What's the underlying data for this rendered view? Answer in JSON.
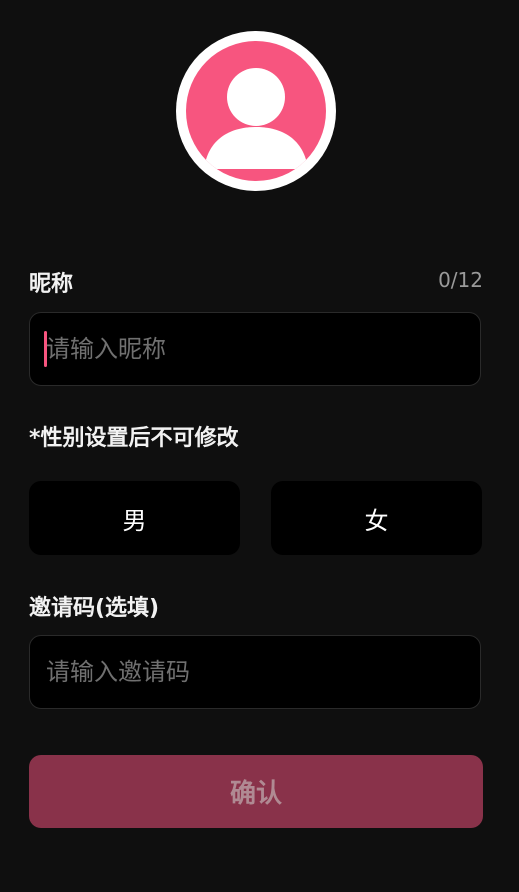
{
  "avatar": {
    "icon": "user-avatar-icon",
    "bg_color": "#f7557f"
  },
  "nickname": {
    "label": "昵称",
    "counter": "0/12",
    "placeholder": "请输入昵称",
    "value": ""
  },
  "gender": {
    "notice": "*性别设置后不可修改",
    "male_label": "男",
    "female_label": "女"
  },
  "invite": {
    "label": "邀请码(选填)",
    "placeholder": "请输入邀请码",
    "value": ""
  },
  "confirm": {
    "label": "确认"
  },
  "colors": {
    "accent": "#f7557f",
    "confirm_bg": "#89324a",
    "background": "#0f0f0f"
  }
}
